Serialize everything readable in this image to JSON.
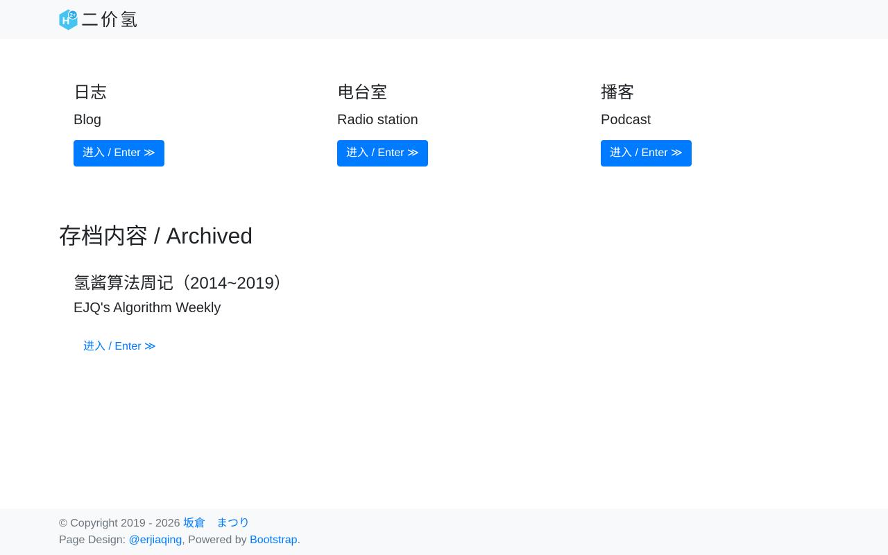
{
  "brand": {
    "name": "二价氢",
    "logo": {
      "letter": "H",
      "badge": "2+"
    }
  },
  "colors": {
    "primary": "#007bff",
    "surface": "#f8f9fa",
    "text": "#212529",
    "muted": "#6c757d",
    "logo_hexagon": "#45c4f2",
    "logo_badge": "#2ba9e8"
  },
  "sections": [
    {
      "title_zh": "日志",
      "title_en": "Blog",
      "button_label": "进入 / Enter ≫"
    },
    {
      "title_zh": "电台室",
      "title_en": "Radio station",
      "button_label": "进入 / Enter ≫"
    },
    {
      "title_zh": "播客",
      "title_en": "Podcast",
      "button_label": "进入 / Enter ≫"
    }
  ],
  "archived": {
    "heading": "存档内容 / Archived",
    "items": [
      {
        "title_zh": "氢酱算法周记（2014~2019）",
        "title_en": "EJQ's Algorithm Weekly",
        "link_label": "进入 / Enter ≫"
      }
    ]
  },
  "footer": {
    "copyright_text": "© Copyright 2019 - 2026 ",
    "author_link": "坂倉　まつり",
    "design_prefix": "Page Design: ",
    "designer_link": "@erjiaqing",
    "powered_middle": ", Powered by ",
    "bootstrap_link": "Bootstrap",
    "period": "."
  }
}
